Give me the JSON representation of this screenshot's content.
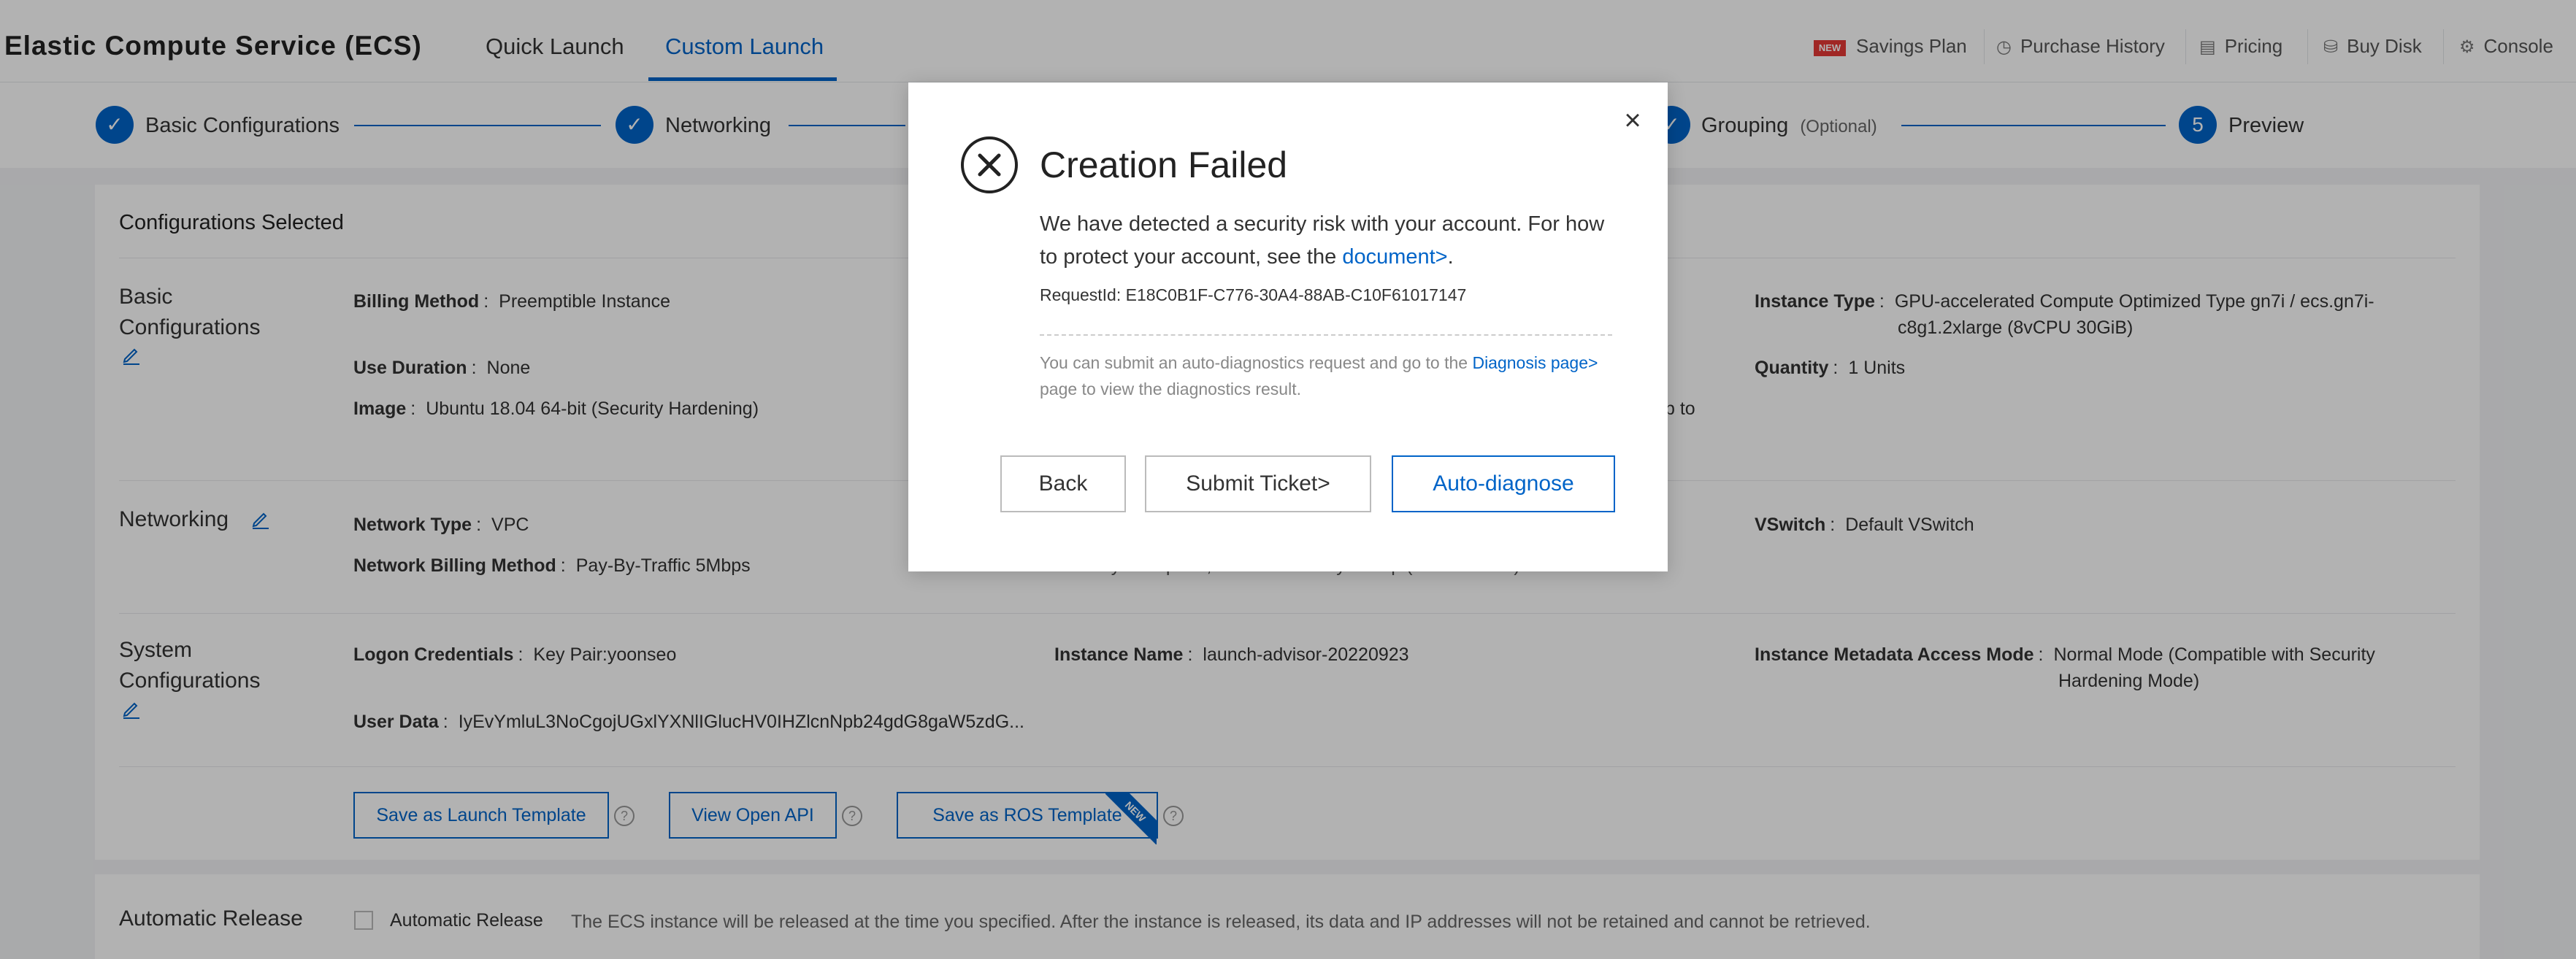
{
  "header": {
    "brand": "Elastic Compute Service (ECS)",
    "tabs": [
      "Quick Launch",
      "Custom Launch"
    ],
    "nav": [
      {
        "label": "Savings Plan",
        "icon": "new-flag-icon",
        "flag": "NEW"
      },
      {
        "label": "Purchase History",
        "icon": "clock-icon"
      },
      {
        "label": "Pricing",
        "icon": "document-icon"
      },
      {
        "label": "Buy Disk",
        "icon": "disk-icon"
      },
      {
        "label": "Console",
        "icon": "gear-icon"
      }
    ]
  },
  "steps": [
    {
      "label": "Basic Configurations",
      "state": "done"
    },
    {
      "label": "Networking",
      "state": "done"
    },
    {
      "label": "Grouping",
      "optional": "(Optional)",
      "state": "done"
    },
    {
      "label": "Preview",
      "number": "5",
      "state": "active"
    }
  ],
  "card": {
    "title": "Configurations Selected",
    "basic": {
      "title_lines": [
        "Basic",
        "Configurations"
      ],
      "billing_method": {
        "key": "Billing Method",
        "value": "Preemptible Instance"
      },
      "use_duration": {
        "key": "Use Duration",
        "value": "None"
      },
      "image": {
        "key": "Image",
        "value": "Ubuntu 18.04 64-bit  (Security Hardening)"
      },
      "instance_type": {
        "key": "Instance Type",
        "value_lines": [
          "GPU-accelerated Compute Optimized Type gn7i / ecs.gn7i-",
          "c8g1.2xlarge  (8vCPU 30GiB)"
        ]
      },
      "quantity": {
        "key": "Quantity",
        "value": "1 Units"
      },
      "fragment": "p to"
    },
    "networking": {
      "title": "Networking",
      "network_type": {
        "key": "Network Type",
        "value": "VPC"
      },
      "network_billing": {
        "key": "Network Billing Method",
        "value": "Pay-By-Traffic 5Mbps"
      },
      "vswitch": {
        "key": "VSwitch",
        "value": "Default VSwitch"
      },
      "security_group_partial": "Security Group :  ..., Default Security Group (Custom Port)"
    },
    "system": {
      "title_lines": [
        "System",
        "Configurations"
      ],
      "logon": {
        "key": "Logon Credentials",
        "value": "Key Pair:yoonseo"
      },
      "instance_name": {
        "key": "Instance Name",
        "value": "launch-advisor-20220923"
      },
      "metadata": {
        "key": "Instance Metadata Access Mode",
        "value_lines": [
          "Normal Mode (Compatible with Security",
          "Hardening Mode)"
        ]
      },
      "user_data": {
        "key": "User Data",
        "value": "IyEvYmluL3NoCgojUGxlYXNlIGlucHV0IHZlcnNpb24gdG8gaW5zdG..."
      }
    },
    "buttons": {
      "save_launch_template": "Save as Launch Template",
      "view_open_api": "View Open API",
      "save_ros_template": "Save as ROS Template",
      "new_badge": "NEW"
    }
  },
  "release": {
    "title": "Automatic Release",
    "checkbox_label": "Automatic Release",
    "description": "The ECS instance will be released at the time you specified. After the instance is released, its data and IP addresses will not be retained and cannot be retrieved."
  },
  "modal": {
    "title": "Creation Failed",
    "message_before_link": "We have detected a security risk with your account. For how to protect your account, see the ",
    "message_link": "document>",
    "message_after_link": ".",
    "request_id": "RequestId: E18C0B1F-C776-30A4-88AB-C10F61017147",
    "diag_before_link": "You can submit an auto-diagnostics request and go to the ",
    "diag_link": "Diagnosis page>",
    "diag_after_link": " page to view the diagnostics result.",
    "buttons": {
      "back": "Back",
      "submit_ticket": "Submit Ticket>",
      "auto_diagnose": "Auto-diagnose"
    },
    "close": "×"
  },
  "colors": {
    "accent": "#0064c8",
    "new_flag": "#e53935"
  }
}
